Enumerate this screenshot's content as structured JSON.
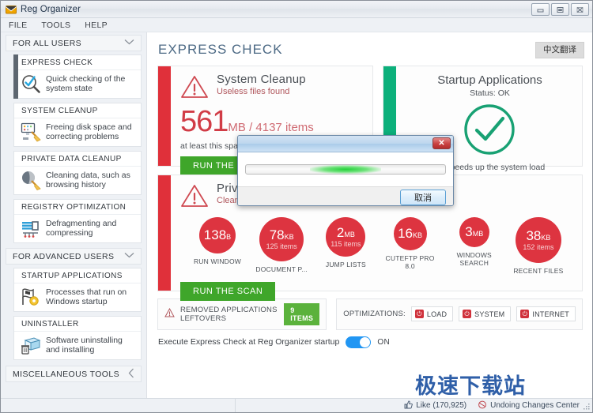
{
  "window": {
    "title": "Reg Organizer",
    "icon": "app-icon",
    "controls": {
      "minimize": "minimize-icon",
      "maximize": "maximize-icon",
      "close": "close-icon"
    }
  },
  "menubar": {
    "items": [
      "FILE",
      "TOOLS",
      "HELP"
    ]
  },
  "sidebar": {
    "groups": [
      {
        "label": "FOR ALL USERS",
        "chevron": "chevron-down-icon",
        "items": [
          {
            "title": "EXPRESS CHECK",
            "desc": "Quick checking of the system state",
            "icon": "magnifier-check-icon",
            "selected": true
          },
          {
            "title": "SYSTEM CLEANUP",
            "desc": "Freeing disk space and correcting problems",
            "icon": "monitor-broom-icon",
            "selected": false
          },
          {
            "title": "PRIVATE DATA CLEANUP",
            "desc": "Cleaning data, such as browsing history",
            "icon": "globe-broom-icon",
            "selected": false
          },
          {
            "title": "REGISTRY OPTIMIZATION",
            "desc": "Defragmenting and compressing",
            "icon": "registry-defrag-icon",
            "selected": false
          }
        ]
      },
      {
        "label": "FOR ADVANCED USERS",
        "chevron": "chevron-down-icon",
        "items": [
          {
            "title": "STARTUP APPLICATIONS",
            "desc": "Processes that run on Windows startup",
            "icon": "flag-gear-icon",
            "selected": false
          },
          {
            "title": "UNINSTALLER",
            "desc": "Software uninstalling and installing",
            "icon": "box-trash-icon",
            "selected": false
          }
        ]
      },
      {
        "label": "MISCELLANEOUS TOOLS",
        "chevron": "chevron-left-icon",
        "items": []
      }
    ]
  },
  "main": {
    "page_title": "EXPRESS CHECK",
    "translate_button": "中文翻译",
    "system_cleanup": {
      "accent_color": "#e0303a",
      "icon": "warning-triangle-icon",
      "title": "System Cleanup",
      "subtitle": "Useless files found",
      "value": "561",
      "unit": "MB / 4137 items",
      "note": "at least this spac",
      "button": "RUN THE SCAN"
    },
    "startup_applications": {
      "accent_color": "#0cb07b",
      "title": "Startup Applications",
      "status": "Status: OK",
      "icon": "green-check-circle-icon",
      "footer": "on speeds up the system load"
    },
    "private_data_cleanup": {
      "accent_color": "#e0303a",
      "icon": "warning-triangle-icon",
      "title": "Private Data Cleanup",
      "subtitle": "Cleanup is available for the below items",
      "button": "RUN THE SCAN",
      "circles": [
        {
          "num": "138",
          "unit": "B",
          "items": "",
          "label": "RUN WINDOW",
          "size": 46
        },
        {
          "num": "78",
          "unit": "KB",
          "items": "125 items",
          "label": "DOCUMENT P...",
          "size": 56
        },
        {
          "num": "2",
          "unit": "MB",
          "items": "115 items",
          "label": "JUMP LISTS",
          "size": 50
        },
        {
          "num": "16",
          "unit": "KB",
          "items": "",
          "label": "CUTEFTP PRO 8.0",
          "size": 42
        },
        {
          "num": "3",
          "unit": "MB",
          "items": "",
          "label": "WINDOWS SEARCH",
          "size": 38
        },
        {
          "num": "38",
          "unit": "KB",
          "items": "152 items",
          "label": "RECENT FILES",
          "size": 58
        }
      ]
    },
    "leftovers_strip": {
      "icon": "warning-triangle-small-icon",
      "label": "REMOVED APPLICATIONS LEFTOVERS",
      "badge": "9 ITEMS",
      "badge_color": "#5bb23c"
    },
    "optimizations_strip": {
      "label": "OPTIMIZATIONS:",
      "buttons": [
        {
          "label": "LOAD",
          "icon": "power-icon"
        },
        {
          "label": "SYSTEM",
          "icon": "power-icon"
        },
        {
          "label": "INTERNET",
          "icon": "power-icon"
        }
      ]
    },
    "express_toggle": {
      "text": "Execute Express Check at Reg Organizer startup",
      "state": "ON",
      "color": "#2196f3"
    }
  },
  "statusbar": {
    "like": {
      "icon": "thumbs-up-icon",
      "label": "Like (170,925)"
    },
    "undo": {
      "icon": "undo-circle-icon",
      "label": "Undoing Changes Center"
    },
    "grip": "resize-grip-icon"
  },
  "dialog": {
    "title": "",
    "close": "✕",
    "progress": {
      "type": "indeterminate-marquee"
    },
    "cancel_button": "取消"
  },
  "watermark": "极速下载站"
}
